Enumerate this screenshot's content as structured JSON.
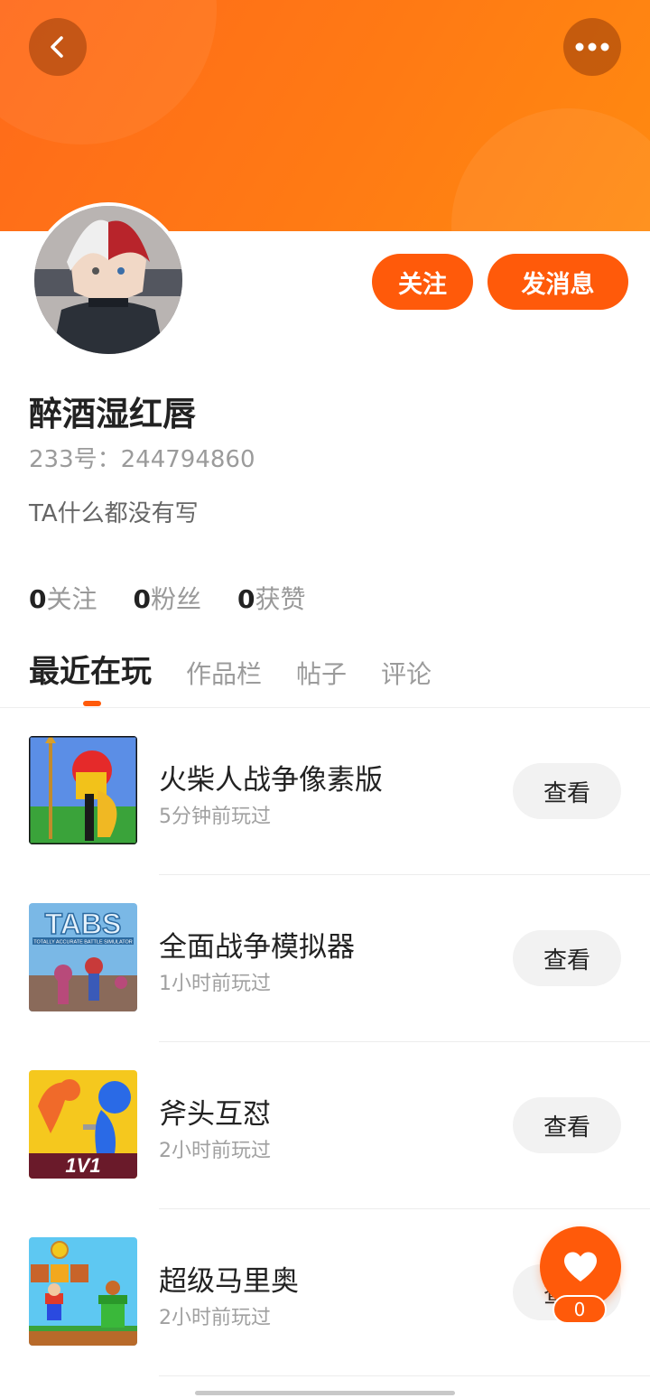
{
  "header": {
    "back_icon": "chevron-left-icon",
    "more_icon": "more-dots-icon",
    "accent_color": "#ff6a1a"
  },
  "profile": {
    "username": "醉酒湿红唇",
    "uid_text": "233号：244794860",
    "bio": "TA什么都没有写",
    "follow_label": "关注",
    "message_label": "发消息"
  },
  "stats": [
    {
      "num": "0",
      "label": "关注"
    },
    {
      "num": "0",
      "label": "粉丝"
    },
    {
      "num": "0",
      "label": "获赞"
    }
  ],
  "tabs": [
    {
      "label": "最近在玩",
      "active": true
    },
    {
      "label": "作品栏",
      "active": false
    },
    {
      "label": "帖子",
      "active": false
    },
    {
      "label": "评论",
      "active": false
    }
  ],
  "games": [
    {
      "name": "火柴人战争像素版",
      "time": "5分钟前玩过",
      "button": "查看"
    },
    {
      "name": "全面战争模拟器",
      "time": "1小时前玩过",
      "button": "查看",
      "thumb_text": "TABS",
      "thumb_subtext": "TOTALLY ACCURATE BATTLE SIMULATOR"
    },
    {
      "name": "斧头互怼",
      "time": "2小时前玩过",
      "button": "查看",
      "thumb_text": "1V1"
    },
    {
      "name": "超级马里奥",
      "time": "2小时前玩过",
      "button": "查看"
    }
  ],
  "fab": {
    "icon": "heart-icon",
    "count": "0"
  }
}
